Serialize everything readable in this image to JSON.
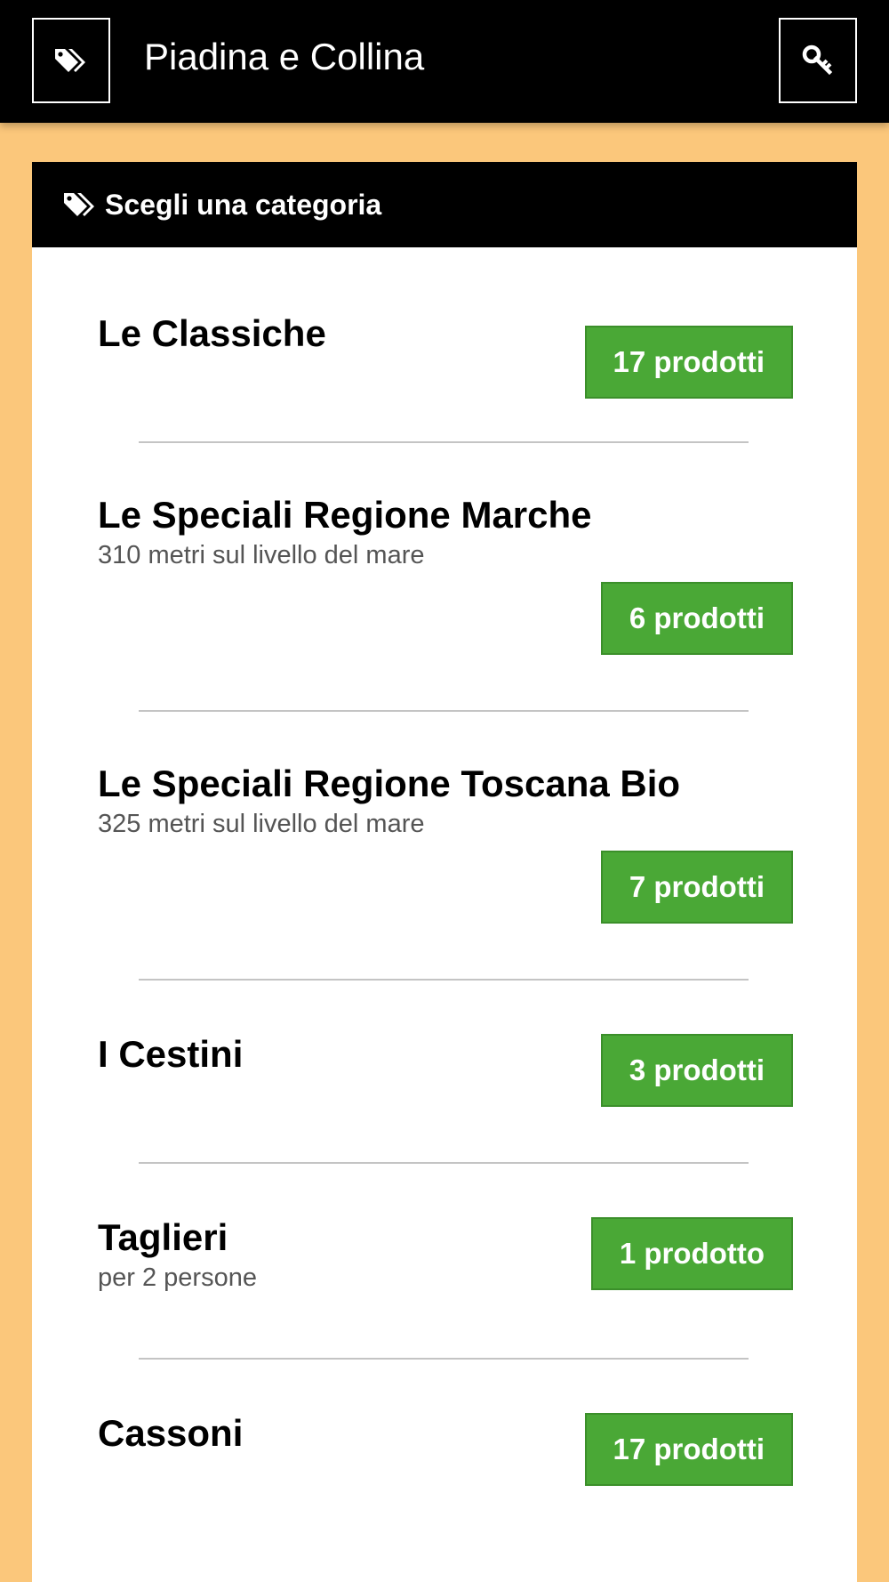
{
  "header": {
    "title": "Piadina e Collina",
    "left_icon": "tags-icon",
    "right_icon": "key-icon"
  },
  "panel": {
    "title": "Scegli una categoria",
    "title_icon": "tags-icon"
  },
  "categories": [
    {
      "name": "Le Classiche",
      "subtitle": "",
      "count_label": "17 prodotti"
    },
    {
      "name": "Le Speciali Regione Marche",
      "subtitle": "310 metri sul livello del mare",
      "count_label": "6 prodotti"
    },
    {
      "name": "Le Speciali Regione Toscana Bio",
      "subtitle": "325 metri sul livello del mare",
      "count_label": "7 prodotti"
    },
    {
      "name": "I Cestini",
      "subtitle": "",
      "count_label": "3 prodotti"
    },
    {
      "name": "Taglieri",
      "subtitle": "per 2 persone",
      "count_label": "1 prodotto"
    },
    {
      "name": "Cassoni",
      "subtitle": "",
      "count_label": "17 prodotti"
    }
  ],
  "colors": {
    "background": "#fbc77b",
    "header": "#000000",
    "badge": "#4aa836"
  }
}
